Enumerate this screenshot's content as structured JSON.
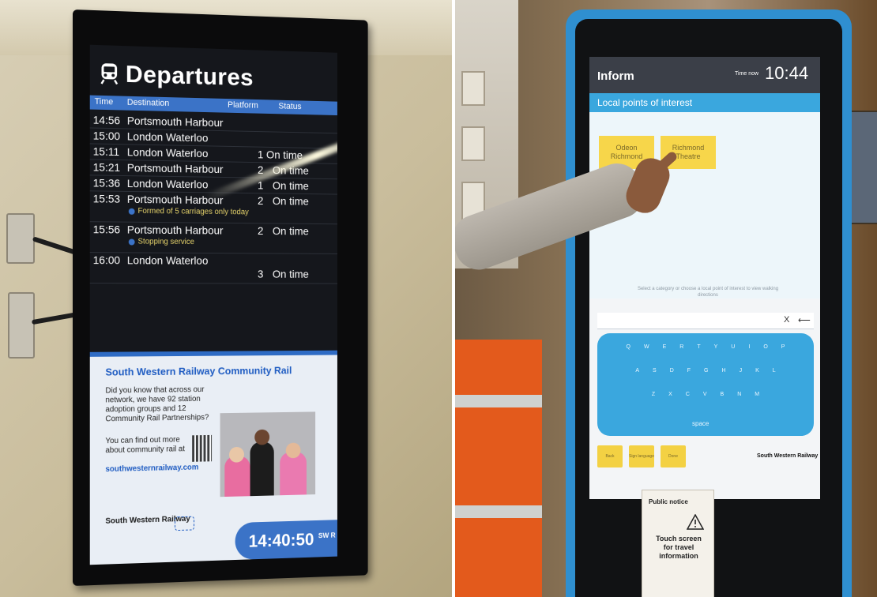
{
  "departures": {
    "title": "Departures",
    "columns": [
      "Time",
      "Destination",
      "Platform",
      "Status"
    ],
    "rows": [
      {
        "time": "14:56",
        "destination": "Portsmouth Harbour",
        "platform": "",
        "status": "",
        "note": ""
      },
      {
        "time": "15:00",
        "destination": "London Waterloo",
        "platform": "",
        "status": "",
        "note": ""
      },
      {
        "time": "15:11",
        "destination": "London Waterloo",
        "platform": "",
        "status": "",
        "note": ""
      },
      {
        "time": "15:21",
        "destination": "Portsmouth Harbour",
        "platform": "2",
        "status": "On time",
        "note": ""
      },
      {
        "time": "15:36",
        "destination": "London Waterloo",
        "platform": "1",
        "status": "On time",
        "note": ""
      },
      {
        "time": "15:53",
        "destination": "Portsmouth Harbour",
        "platform": "2",
        "status": "On time",
        "note": "Formed of 5 carriages only today"
      },
      {
        "time": "15:56",
        "destination": "Portsmouth Harbour",
        "platform": "2",
        "status": "On time",
        "note": "Stopping service"
      },
      {
        "time": "16:00",
        "destination": "London Waterloo",
        "platform": "3",
        "status": "On time",
        "note": ""
      }
    ],
    "extra_status": "1 On time",
    "ad": {
      "title": "South Western Railway Community Rail",
      "text1": "Did you know that across our network, we have 92 station adoption groups and 12 Community Rail Partnerships?",
      "text2": "You can find out more about community rail at",
      "link": "southwesternrailway.com",
      "logo": "South Western Railway"
    },
    "clock": "14:40:50",
    "clock_logo": "SW R"
  },
  "kiosk": {
    "app_title": "Inform",
    "time_label": "Time now",
    "time": "10:44",
    "section": "Local points of interest",
    "poi": [
      "Odeon Richmond",
      "Richmond Theatre"
    ],
    "instruction": "Select a category or choose a local point of interest to view walking directions",
    "keyboard_rows": [
      [
        "Q",
        "W",
        "E",
        "R",
        "T",
        "Y",
        "U",
        "I",
        "O",
        "P"
      ],
      [
        "A",
        "S",
        "D",
        "F",
        "G",
        "H",
        "J",
        "K",
        "L"
      ],
      [
        "Z",
        "X",
        "C",
        "V",
        "B",
        "N",
        "M"
      ]
    ],
    "space_label": "space",
    "buttons": [
      "Back",
      "Sign language",
      "Done"
    ],
    "logo": "South Western Railway",
    "notice_head": "Public notice",
    "notice_body": "Touch screen for travel information"
  }
}
